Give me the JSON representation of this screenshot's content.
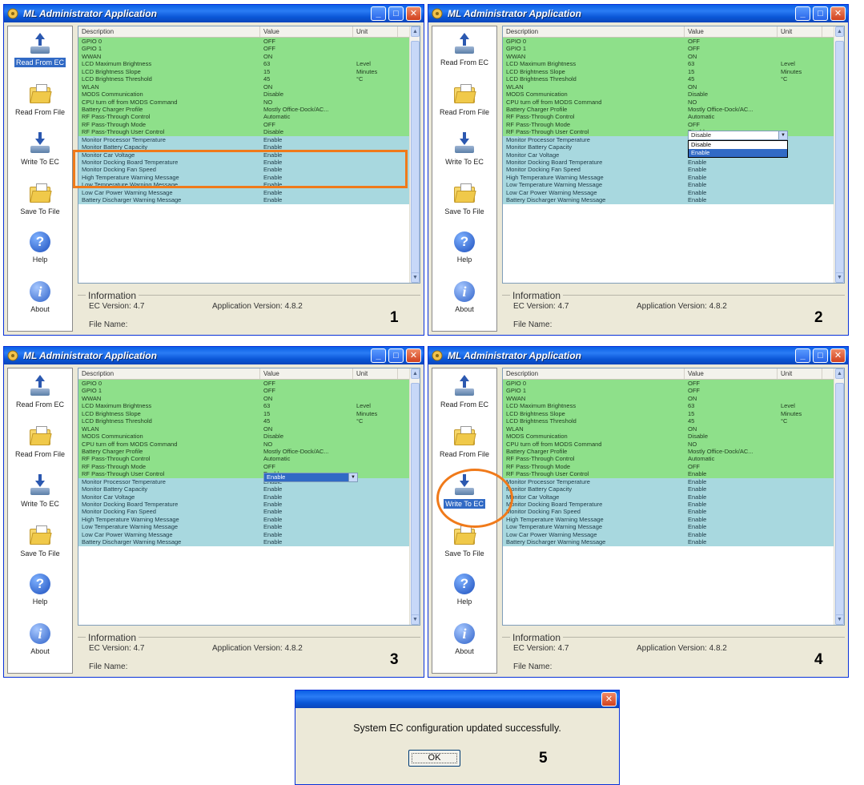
{
  "window_title": "ML Administrator Application",
  "sidebar": [
    {
      "id": "read-from-ec",
      "label": "Read From EC",
      "icon": "upload-icon"
    },
    {
      "id": "read-from-file",
      "label": "Read From File",
      "icon": "folder-open-icon"
    },
    {
      "id": "write-to-ec",
      "label": "Write To EC",
      "icon": "download-icon"
    },
    {
      "id": "save-to-file",
      "label": "Save To File",
      "icon": "folder-save-icon"
    },
    {
      "id": "help",
      "label": "Help",
      "icon": "help-icon"
    },
    {
      "id": "about",
      "label": "About",
      "icon": "info-icon"
    }
  ],
  "columns": {
    "description": "Description",
    "value": "Value",
    "unit": "Unit"
  },
  "rows": [
    {
      "description": "GPIO 0",
      "value": "OFF",
      "unit": ""
    },
    {
      "description": "GPIO 1",
      "value": "OFF",
      "unit": ""
    },
    {
      "description": "WWAN",
      "value": "ON",
      "unit": ""
    },
    {
      "description": "LCD Maximum Brightness",
      "value": "63",
      "unit": "Level"
    },
    {
      "description": "LCD Brightness Slope",
      "value": "15",
      "unit": "Minutes"
    },
    {
      "description": "LCD Brightness Threshold",
      "value": "45",
      "unit": "°C"
    },
    {
      "description": "WLAN",
      "value": "ON",
      "unit": ""
    },
    {
      "description": "MODS Communication",
      "value": "Disable",
      "unit": ""
    },
    {
      "description": "CPU turn off from MODS Command",
      "value": "NO",
      "unit": ""
    },
    {
      "description": "Battery Charger Profile",
      "value": "Mostly Office-Dock/AC...",
      "unit": ""
    },
    {
      "description": "RF Pass-Through Control",
      "value": "Automatic",
      "unit": ""
    },
    {
      "description": "RF Pass-Through Mode",
      "value": "OFF",
      "unit": ""
    },
    {
      "description": "RF Pass-Through User Control",
      "value": "Disable",
      "unit": ""
    },
    {
      "description": "Monitor Processor Temperature",
      "value": "Enable",
      "unit": ""
    },
    {
      "description": "Monitor Battery Capacity",
      "value": "Enable",
      "unit": ""
    },
    {
      "description": "Monitor Car Voltage",
      "value": "Enable",
      "unit": ""
    },
    {
      "description": "Monitor Docking Board Temperature",
      "value": "Enable",
      "unit": ""
    },
    {
      "description": "Monitor Docking Fan Speed",
      "value": "Enable",
      "unit": ""
    },
    {
      "description": "High Temperature Warning Message",
      "value": "Enable",
      "unit": ""
    },
    {
      "description": "Low Temperature Warning Message",
      "value": "Enable",
      "unit": ""
    },
    {
      "description": "Low Car Power Warning Message",
      "value": "Enable",
      "unit": ""
    },
    {
      "description": "Battery Discharger Warning Message",
      "value": "Enable",
      "unit": ""
    }
  ],
  "info": {
    "title": "Information",
    "ec_version": "EC Version:  4.7",
    "app_version": "Application Version:  4.8.2",
    "file_name": "File Name:"
  },
  "panels": [
    {
      "step": "1",
      "active": "read-from-ec",
      "rf_user_value": "Disable"
    },
    {
      "step": "2",
      "active": "",
      "rf_user_value": "Disable",
      "dropdown_options": [
        "Disable",
        "Enable"
      ],
      "dropdown_highlight": "Enable"
    },
    {
      "step": "3",
      "active": "",
      "rf_user_value": "Enable"
    },
    {
      "step": "4",
      "active": "write-to-ec",
      "rf_user_value": "Enable"
    }
  ],
  "dialog": {
    "message": "System EC configuration updated successfully.",
    "ok_label": "OK",
    "step": "5"
  },
  "colors": {
    "row_green": "#8ee08a",
    "row_blue": "#a8d8df",
    "highlight": "#f07a1a",
    "selection": "#316ac5"
  }
}
